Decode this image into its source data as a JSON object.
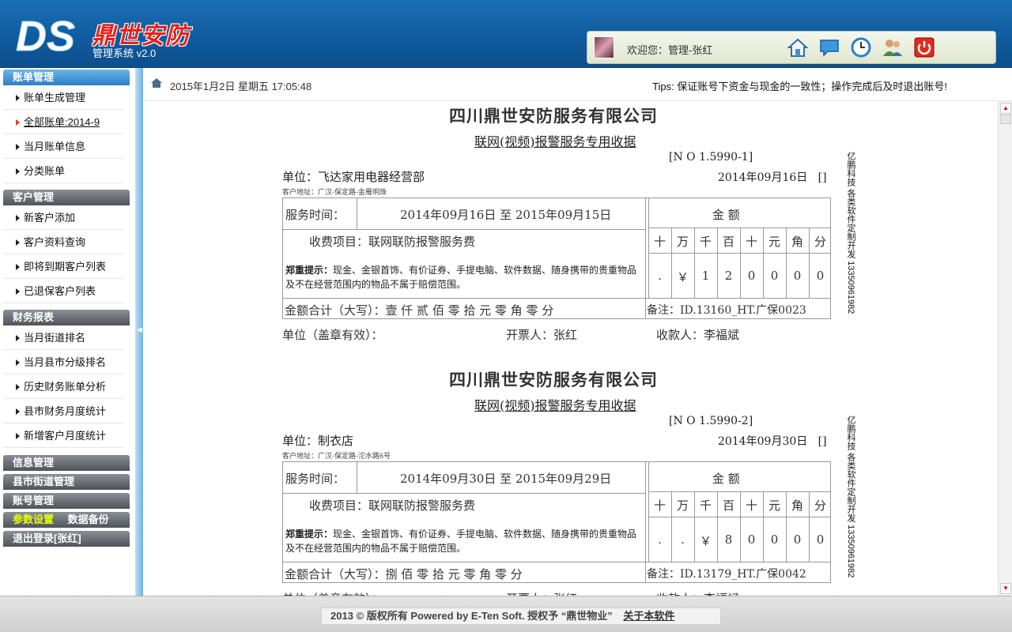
{
  "header": {
    "logo_text": "DS",
    "brand": "鼎世安防",
    "subtitle": "管理系统 v2.0",
    "welcome": "欢迎您：管理-张红",
    "toolbar_icons": [
      "home-icon",
      "message-icon",
      "clock-icon",
      "users-icon",
      "power-icon"
    ]
  },
  "sidebar": {
    "sections": [
      {
        "title": "账单管理",
        "items": [
          "账单生成管理",
          "全部账单:2014-9",
          "当月账单信息",
          "分类账单"
        ]
      },
      {
        "title": "客户管理",
        "items": [
          "新客户添加",
          "客户资料查询",
          "即将到期客户列表",
          "已退保客户列表"
        ]
      },
      {
        "title": "财务报表",
        "items": [
          "当月街道排名",
          "当月县市分级排名",
          "历史财务账单分析",
          "县市财务月度统计",
          "新增客户月度统计"
        ]
      },
      {
        "title": "信息管理"
      },
      {
        "title": "县市街道管理"
      },
      {
        "title": "账号管理"
      },
      {
        "title": "参数设置",
        "title2": "数据备份"
      },
      {
        "title": "退出登录[张红]"
      }
    ]
  },
  "topbar": {
    "datetime": "2015年1月2日 星期五 17:05:48",
    "tips": "Tips: 保证账号下资金与现金的一致性；操作完成后及时退出账号!"
  },
  "receipt_labels": {
    "company": "四川鼎世安防服务有限公司",
    "title": "联网(视频)报警服务专用收据",
    "unit_label": "单位：",
    "addr_label": "客户地址：",
    "service_label": "服务时间：",
    "amount_label": "金        额",
    "item": "收费项目：联网联防报警服务费",
    "note_bold": "郑重提示：",
    "note": "现金、金银首饰、有价证券、手提电脑、软件数据、随身携带的贵重物品及不在经营范围内的物品不属于赔偿范围。",
    "total_label": "金额合计（大写）：",
    "remark_label": "备注：",
    "seal": "单位（盖章有效）：",
    "issuer": "开票人：张红",
    "payee": "收款人：李福斌",
    "side_text": "亿鹏科技 各类软件定制开发 13350961982",
    "digit_headers": [
      "十",
      "万",
      "千",
      "百",
      "十",
      "元",
      "角",
      "分"
    ],
    "bracket": "[]"
  },
  "receipts": [
    {
      "no": "[N O   1.5990-1]",
      "unit": "飞达家用电器经营部",
      "date": "2014年09月16日",
      "address": "广汉-保定路-金雁明珠",
      "service_period": "2014年09月16日 至 2015年09月15日",
      "digits": [
        ".",
        "￥",
        "1",
        "2",
        "0",
        "0",
        "0",
        "0"
      ],
      "total_upper": "壹 仟 贰 佰 零 拾 元 零 角 零 分",
      "remark": "ID.13160_HT.广保0023"
    },
    {
      "no": "[N O   1.5990-2]",
      "unit": "制衣店",
      "date": "2014年09月30日",
      "address": "广汉-保定路-沱水路6号",
      "service_period": "2014年09月30日 至 2015年09月29日",
      "digits": [
        ".",
        ".",
        "￥",
        "8",
        "0",
        "0",
        "0",
        "0"
      ],
      "total_upper": "捌 佰 零 拾 元 零 角 零 分",
      "remark": "ID.13179_HT.广保0042"
    }
  ],
  "footer": {
    "copyright": "2013 © 版权所有  Powered by E-Ten Soft.  授权予 “鼎世物业”",
    "about_link": "关于本软件"
  },
  "colors": {
    "header_blue": "#0f5a9e",
    "brand_red": "#e8221a",
    "active_yellow": "#e6ff00"
  }
}
